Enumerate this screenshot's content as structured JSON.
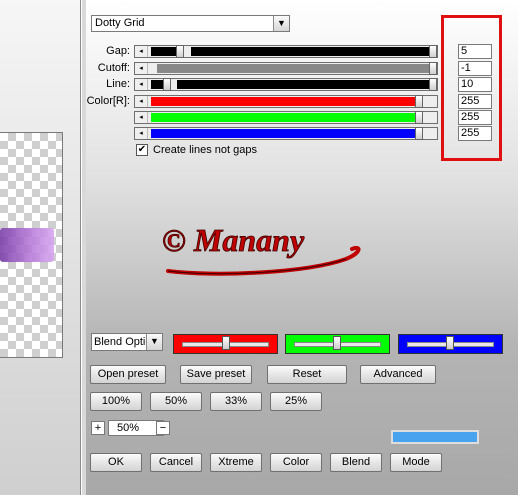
{
  "preset_dropdown": {
    "value": "Dotty Grid"
  },
  "sliders": [
    {
      "label": "Gap:",
      "value": "5"
    },
    {
      "label": "Cutoff:",
      "value": "-1"
    },
    {
      "label": "Line:",
      "value": "10"
    },
    {
      "label": "Color[R]:",
      "value": "255"
    },
    {
      "label": "",
      "value": "255"
    },
    {
      "label": "",
      "value": "255"
    }
  ],
  "checkbox": {
    "label": "Create lines not gaps",
    "checked_glyph": "✔"
  },
  "watermark": {
    "text": "© Manany"
  },
  "blend_select": {
    "value": "Blend Optio"
  },
  "buttons": {
    "open_preset": "Open preset",
    "save_preset": "Save preset",
    "reset": "Reset",
    "advanced": "Advanced",
    "z100": "100%",
    "z50": "50%",
    "z33": "33%",
    "z25": "25%",
    "plus": "+",
    "minus": "−",
    "ok": "OK",
    "cancel": "Cancel",
    "xtreme": "Xtreme",
    "color": "Color",
    "blend": "Blend",
    "mode": "Mode"
  },
  "zoom": {
    "value": "50%"
  },
  "colors": {
    "red": "#ff0000",
    "green": "#00ff00",
    "blue": "#0000ff",
    "highlight": "#e01010",
    "progress": "#4aa3ef"
  },
  "icons": {
    "dropdown": "chevron-down-icon",
    "check": "check-icon",
    "slider_left": "arrow-left-icon"
  }
}
